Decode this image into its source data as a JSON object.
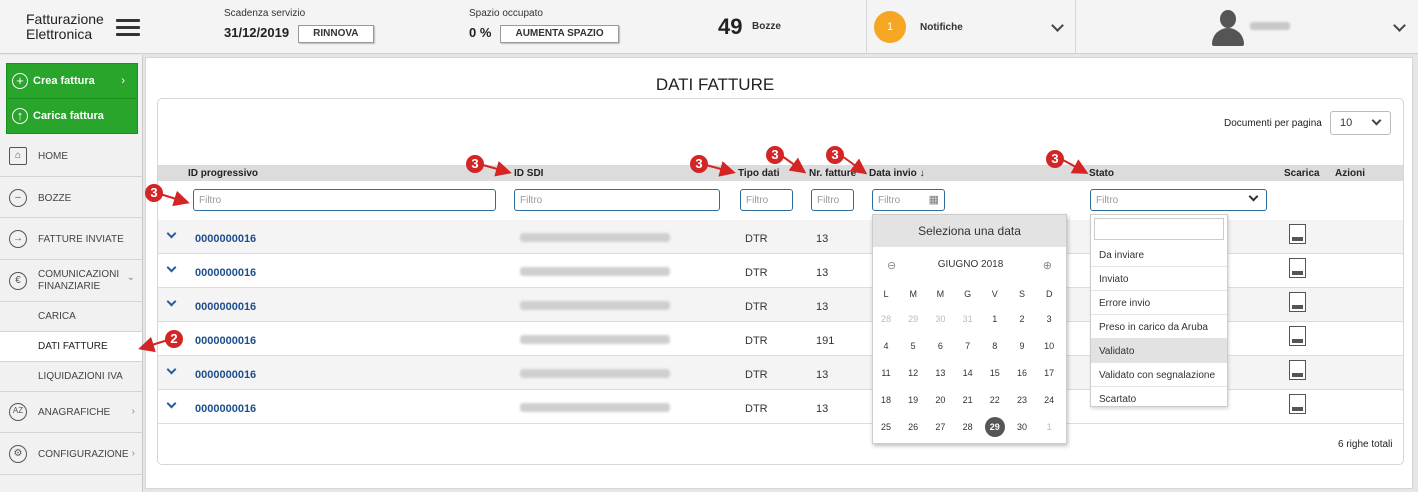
{
  "header": {
    "brand_line1": "Fatturazione",
    "brand_line2": "Elettronica",
    "scadenza_caption": "Scadenza servizio",
    "scadenza_value": "31/12/2019",
    "rinnova_label": "RINNOVA",
    "spazio_caption": "Spazio occupato",
    "spazio_value": "0 %",
    "aumenta_label": "AUMENTA SPAZIO",
    "bozze_count": "49",
    "bozze_label": "Bozze",
    "notifiche_count": "1",
    "notifiche_label": "Notifiche",
    "accent_color": "#f5a623"
  },
  "sidebar": {
    "crea_label": "Crea fattura",
    "carica_label": "Carica fattura",
    "items": [
      {
        "label": "HOME",
        "icon": "home-icon"
      },
      {
        "label": "BOZZE",
        "icon": "drafts-icon"
      },
      {
        "label": "FATTURE INVIATE",
        "icon": "sent-arrow-icon"
      },
      {
        "label_line1": "COMUNICAZIONI",
        "label_line2": "FINANZIARIE",
        "icon": "finance-icon"
      },
      {
        "label": "ANAGRAFICHE",
        "icon": "az-icon"
      },
      {
        "label": "CONFIGURAZIONE",
        "icon": "gear-icon"
      }
    ],
    "sub_items": [
      "CARICA",
      "DATI FATTURE",
      "LIQUIDAZIONI IVA"
    ],
    "green_color": "#2aa52c"
  },
  "main": {
    "title": "DATI FATTURE",
    "per_page_label": "Documenti per pagina",
    "per_page_value": "10",
    "columns": {
      "id": "ID progressivo",
      "sdi": "ID SDI",
      "tipo": "Tipo dati",
      "nr": "Nr. fatture",
      "data": "Data invio ↓",
      "stato": "Stato",
      "scarica": "Scarica",
      "azioni": "Azioni"
    },
    "filter_placeholder": "Filtro",
    "rows": [
      {
        "id": "0000000016",
        "tipo": "DTR",
        "nr": "13"
      },
      {
        "id": "0000000016",
        "tipo": "DTR",
        "nr": "13"
      },
      {
        "id": "0000000016",
        "tipo": "DTR",
        "nr": "13"
      },
      {
        "id": "0000000016",
        "tipo": "DTR",
        "nr": "191"
      },
      {
        "id": "0000000016",
        "tipo": "DTR",
        "nr": "13"
      },
      {
        "id": "0000000016",
        "tipo": "DTR",
        "nr": "13"
      }
    ],
    "totals": "6 righe totali"
  },
  "calendar": {
    "header": "Seleziona una data",
    "month": "GIUGNO 2018",
    "weekdays": [
      "L",
      "M",
      "M",
      "G",
      "V",
      "S",
      "D"
    ],
    "weeks": [
      [
        "28",
        "29",
        "30",
        "31",
        "1",
        "2",
        "3"
      ],
      [
        "4",
        "5",
        "6",
        "7",
        "8",
        "9",
        "10"
      ],
      [
        "11",
        "12",
        "13",
        "14",
        "15",
        "16",
        "17"
      ],
      [
        "18",
        "19",
        "20",
        "21",
        "22",
        "23",
        "24"
      ],
      [
        "25",
        "26",
        "27",
        "28",
        "29",
        "30",
        "1"
      ]
    ],
    "selected": "29"
  },
  "stato_options": [
    "Da inviare",
    "Inviato",
    "Errore invio",
    "Preso in carico da Aruba",
    "Validato",
    "Validato con segnalazione",
    "Scartato"
  ],
  "stato_highlighted": "Validato",
  "annotations": {
    "badge_2": "2",
    "badge_3": "3",
    "badge_color": "#d32525"
  }
}
